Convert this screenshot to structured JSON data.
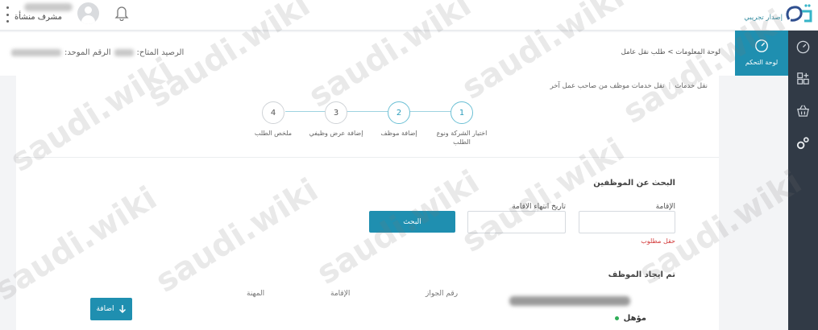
{
  "header": {
    "user_role": "مشرف منشأة",
    "logo_tag": "إصدار تجريبي"
  },
  "sidebar": {
    "dashboard_label": "لوحة التحكم",
    "icons": [
      "speedometer-icon",
      "grid-plus-icon",
      "basket-icon",
      "gears-icon"
    ]
  },
  "mainbar": {
    "breadcrumb": "لوحة المعلومات > طلب نقل عامل",
    "balance_label": "الرصيد المتاح:",
    "unified_number_label": "الرقم الموحد:"
  },
  "subcrumb": {
    "items": [
      "نقل خدمات",
      "نقل خدمات موظف من صاحب عمل آخر"
    ]
  },
  "stepper": {
    "steps": [
      {
        "number": "1",
        "label": "اختيار الشركة ونوع الطلب"
      },
      {
        "number": "2",
        "label": "إضافة موظف"
      },
      {
        "number": "3",
        "label": "إضافة عرض وظيفي"
      },
      {
        "number": "4",
        "label": "ملخص الطلب"
      }
    ],
    "active_steps": [
      1,
      2
    ]
  },
  "search": {
    "title": "البحث عن الموظفين",
    "iqama_label": "الإقامة",
    "iqama_value": "",
    "iqama_error": "حقل مطلوب",
    "expiry_label": "تاريخ انتهاء الاقامة",
    "expiry_value": "",
    "button_label": "البحث"
  },
  "result": {
    "title": "تم ايجاد الموظف",
    "columns": {
      "passport": "رقم الجواز",
      "iqama": "الإقامة",
      "occupation": "المهنة"
    },
    "status": "مؤهل",
    "status_color": "#2fae57",
    "add_label": "اضافة"
  },
  "watermark": "saudi.wiki",
  "colors": {
    "accent": "#1f8fb0",
    "sidebar_bg": "#313a46",
    "error": "#d33c3c"
  }
}
